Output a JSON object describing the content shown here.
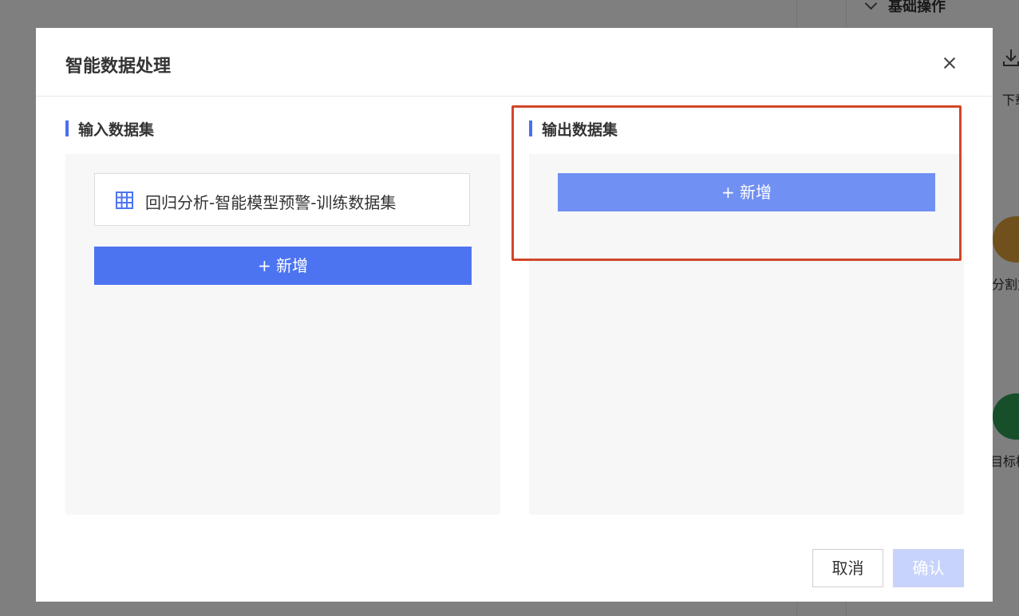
{
  "background": {
    "section_header": "基础操作",
    "download_label": "下载",
    "tool_a_label": "分割方",
    "tool_b_label": "目标检"
  },
  "modal": {
    "title": "智能数据处理",
    "input_section": {
      "title": "输入数据集",
      "items": [
        {
          "label": "回归分析-智能模型预警-训练数据集",
          "icon": "table-icon"
        }
      ],
      "add_label": "+ 新增"
    },
    "output_section": {
      "title": "输出数据集",
      "add_label": "+ 新增"
    },
    "footer": {
      "cancel_label": "取消",
      "confirm_label": "确认"
    }
  },
  "colors": {
    "accent": "#4d74f0",
    "highlight": "#d2462a",
    "confirm_disabled": "#c8d3fb"
  }
}
